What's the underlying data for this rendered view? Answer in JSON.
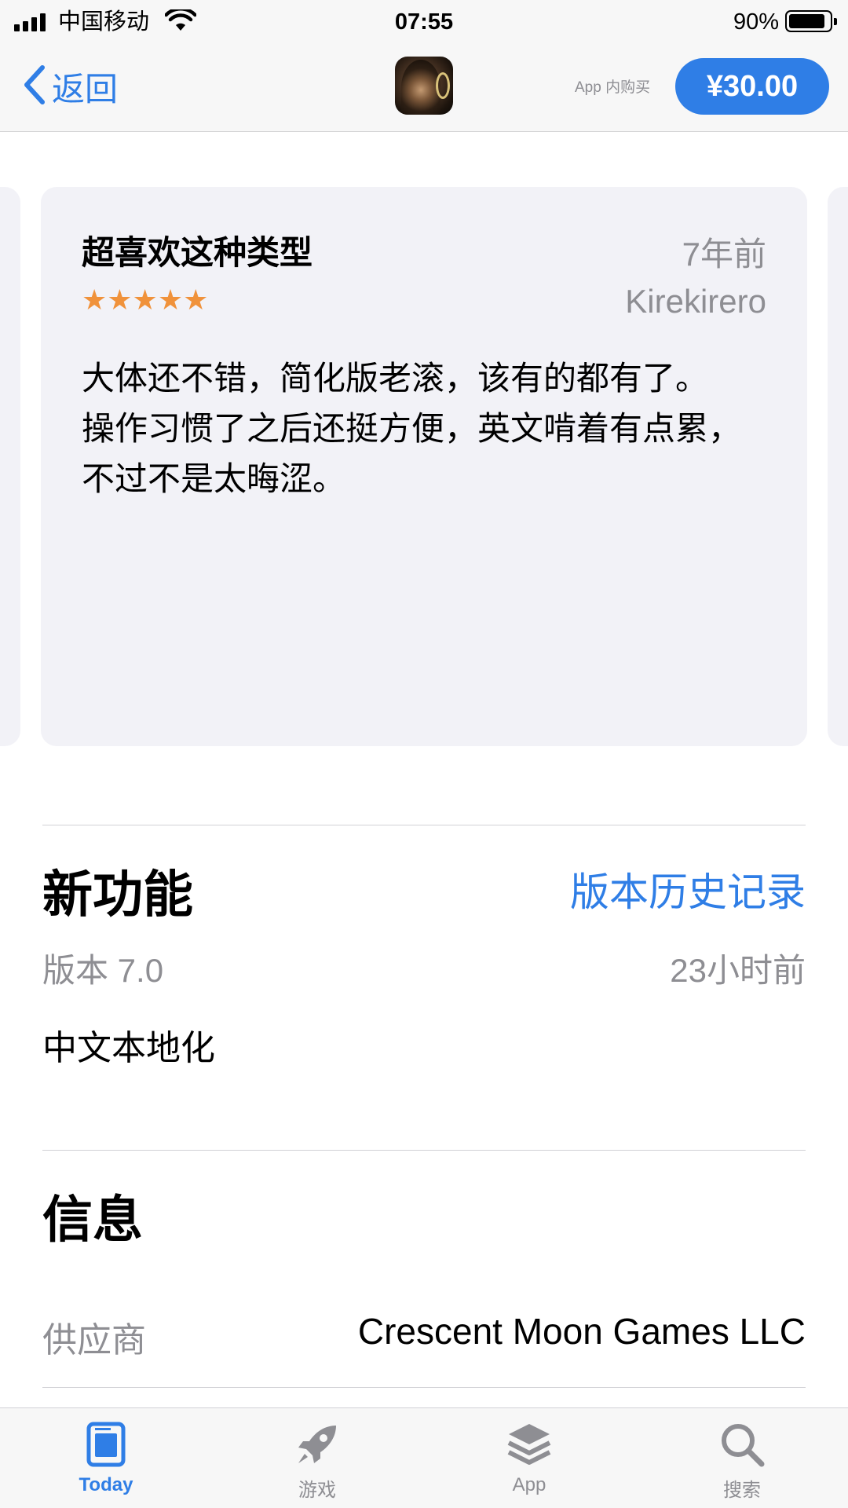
{
  "status_bar": {
    "carrier": "中国移动",
    "time": "07:55",
    "battery_percent": "90%",
    "battery_level": 0.9
  },
  "nav": {
    "back_label": "返回",
    "in_app_purchase": "App 内购买",
    "price": "¥30.00"
  },
  "review": {
    "title": "超喜欢这种类型",
    "date": "7年前",
    "author": "Kirekirero",
    "rating": 5,
    "stars": "★★★★★",
    "body_line1": "大体还不错，简化版老滚，该有的都有了。",
    "body_line2": "操作习惯了之后还挺方便，英文啃着有点累，不过不是太晦涩。"
  },
  "whats_new": {
    "title": "新功能",
    "history_link": "版本历史记录",
    "version": "版本 7.0",
    "time_ago": "23小时前",
    "notes": "中文本地化"
  },
  "info": {
    "title": "信息",
    "provider_label": "供应商",
    "provider_value": "Crescent Moon Games LLC"
  },
  "tab_bar": {
    "items": [
      {
        "label": "Today",
        "icon": "today-icon",
        "active": true
      },
      {
        "label": "游戏",
        "icon": "rocket-icon",
        "active": false
      },
      {
        "label": "App",
        "icon": "layers-icon",
        "active": false
      },
      {
        "label": "搜索",
        "icon": "search-icon",
        "active": false
      }
    ]
  },
  "colors": {
    "accent": "#2f7ee6",
    "star": "#f0923b",
    "secondary_text": "#8e8e93",
    "card_bg": "#f2f2f7"
  }
}
